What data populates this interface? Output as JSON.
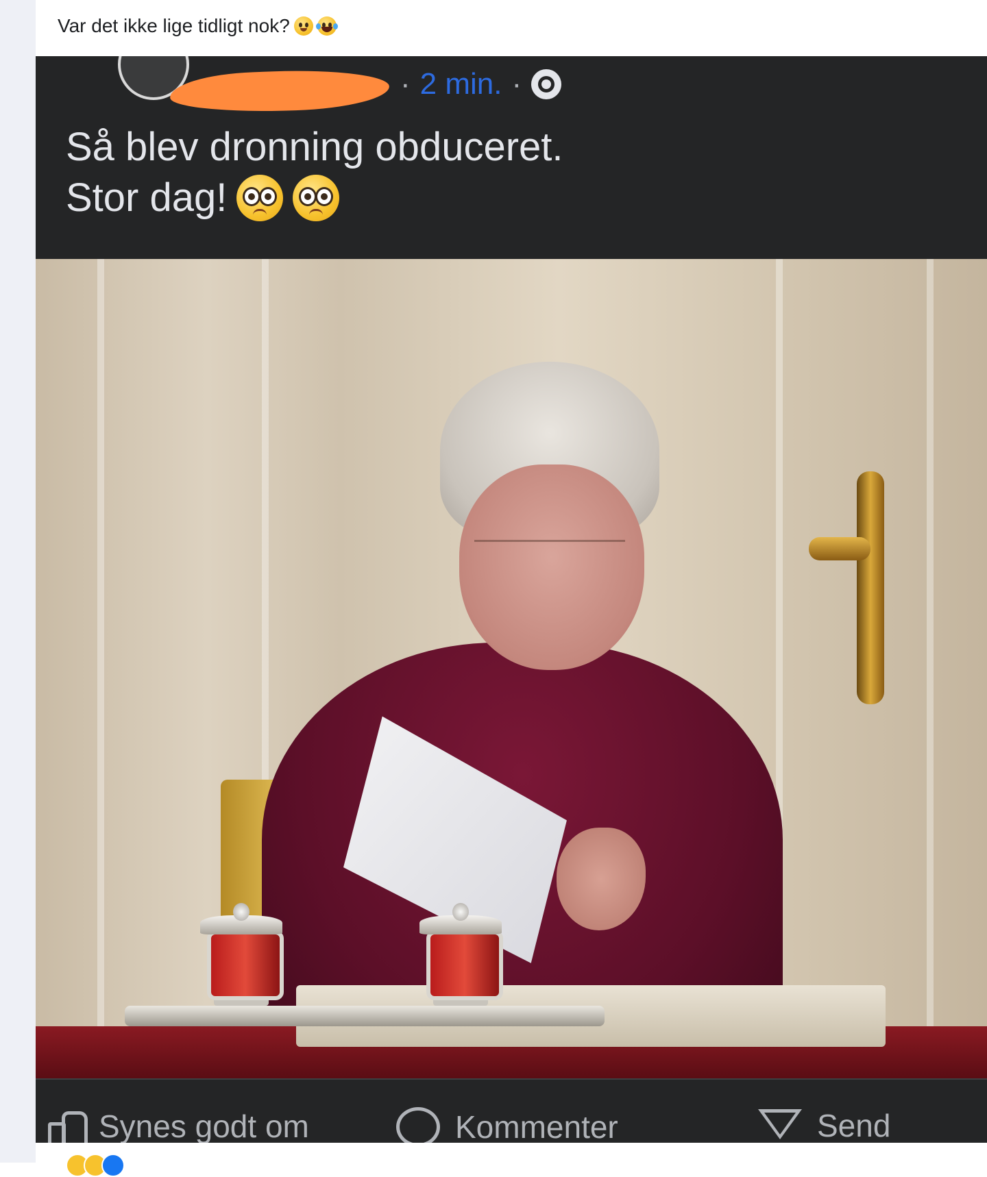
{
  "outer_post": {
    "text": "Var det ikke lige tidligt nok?",
    "emojis": [
      "flushed-face",
      "laughing-tears-face"
    ]
  },
  "embedded_post": {
    "timestamp": "2 min.",
    "separator": "·",
    "audience_icon": "friends-icon",
    "text_line1": "Så blev dronning obduceret.",
    "text_line2": "Stor dag!",
    "text_emojis": [
      "pleading-face",
      "pleading-face"
    ],
    "actions": {
      "like": "Synes godt om",
      "comment": "Kommenter",
      "send": "Send"
    }
  },
  "colors": {
    "embedded_background": "#242526",
    "timestamp": "#2d6be0",
    "redaction": "#ff8a3d",
    "text_light": "#e4e6eb",
    "muted": "#b0b3b8"
  },
  "reaction_icons": [
    "like",
    "haha"
  ]
}
